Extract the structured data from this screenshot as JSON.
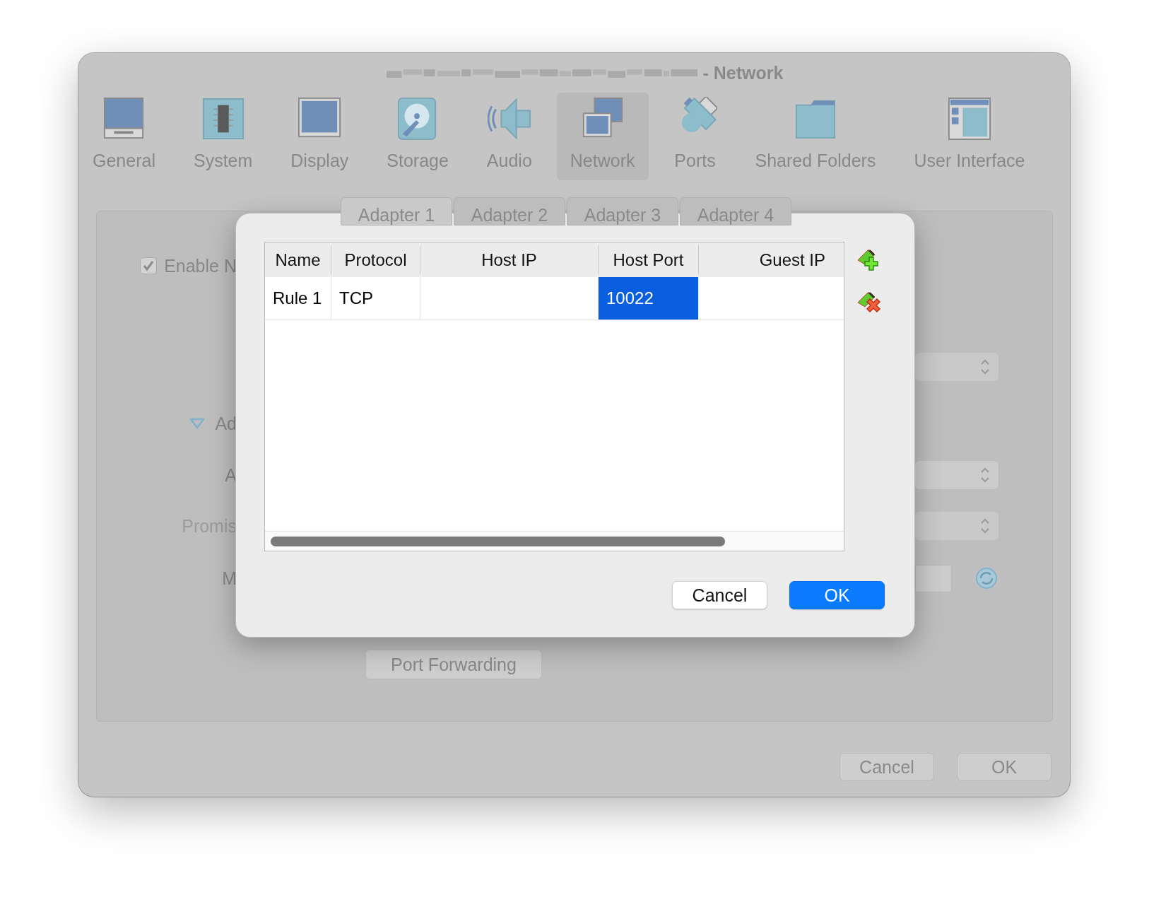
{
  "window": {
    "title": "- Network"
  },
  "toolbar": [
    {
      "label": "General",
      "kind": "general",
      "selected": false
    },
    {
      "label": "System",
      "kind": "system",
      "selected": false
    },
    {
      "label": "Display",
      "kind": "display",
      "selected": false
    },
    {
      "label": "Storage",
      "kind": "storage",
      "selected": false
    },
    {
      "label": "Audio",
      "kind": "audio",
      "selected": false
    },
    {
      "label": "Network",
      "kind": "network",
      "selected": true
    },
    {
      "label": "Ports",
      "kind": "ports",
      "selected": false
    },
    {
      "label": "Shared Folders",
      "kind": "folders",
      "selected": false
    },
    {
      "label": "User Interface",
      "kind": "ui",
      "selected": false
    }
  ],
  "adapter_tabs": [
    {
      "label": "Adapter 1",
      "selected": true
    },
    {
      "label": "Adapter 2",
      "selected": false
    },
    {
      "label": "Adapter 3",
      "selected": false
    },
    {
      "label": "Adapter 4",
      "selected": false
    }
  ],
  "settings": {
    "enable_checkbox": {
      "label": "Enable N",
      "checked": true
    },
    "advanced_toggle": {
      "label": "Ad",
      "expanded": true
    },
    "labels": [
      {
        "text": "A",
        "disabled": false
      },
      {
        "text": "Promis",
        "disabled": true
      },
      {
        "text": "M",
        "disabled": false
      }
    ],
    "port_forwarding_button": "Port Forwarding"
  },
  "buttons": [
    {
      "label": "Cancel",
      "default": false
    },
    {
      "label": "OK",
      "default": false
    }
  ],
  "dialog": {
    "columns": [
      "Name",
      "Protocol",
      "Host IP",
      "Host Port",
      "Guest IP"
    ],
    "rows": [
      {
        "cells": [
          {
            "text": "Rule 1",
            "selected": false
          },
          {
            "text": "TCP",
            "selected": false
          },
          {
            "selected": false
          },
          {
            "text": "10022",
            "selected": true
          },
          {
            "selected": false
          }
        ]
      }
    ],
    "buttons": [
      {
        "label": "Cancel",
        "default": false
      },
      {
        "label": "OK",
        "default": true
      }
    ]
  }
}
